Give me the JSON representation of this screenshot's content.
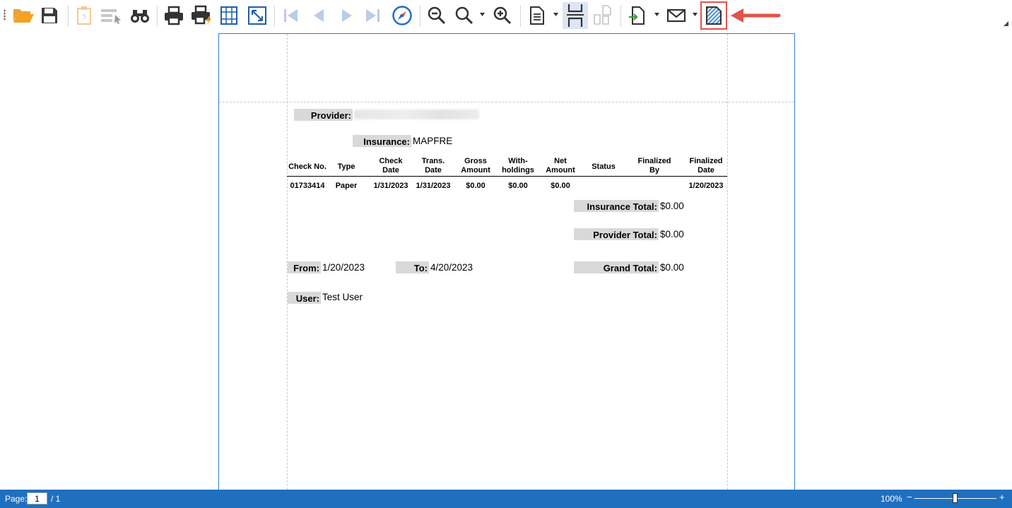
{
  "toolbar": {
    "buttons": [
      {
        "name": "open-icon"
      },
      {
        "name": "save-icon"
      },
      {
        "name": "parameters-icon"
      },
      {
        "name": "document-map-icon"
      },
      {
        "name": "find-icon"
      },
      {
        "name": "print-icon"
      },
      {
        "name": "quick-print-icon"
      },
      {
        "name": "page-setup-icon"
      },
      {
        "name": "scale-icon"
      },
      {
        "name": "first-page-icon"
      },
      {
        "name": "previous-page-icon"
      },
      {
        "name": "next-page-icon"
      },
      {
        "name": "last-page-icon"
      },
      {
        "name": "navigation-icon"
      },
      {
        "name": "zoom-out-icon"
      },
      {
        "name": "zoom-icon"
      },
      {
        "name": "zoom-in-icon"
      },
      {
        "name": "single-page-icon"
      },
      {
        "name": "continuous-scroll-icon"
      },
      {
        "name": "multiple-pages-icon"
      },
      {
        "name": "export-icon"
      },
      {
        "name": "send-email-icon"
      },
      {
        "name": "watermark-icon"
      }
    ],
    "highlight_color": "#e0534a"
  },
  "report": {
    "provider_label": "Provider:",
    "insurance_label": "Insurance:",
    "insurance_value": "MAPFRE",
    "columns": [
      {
        "key": "check_no",
        "label": "Check No."
      },
      {
        "key": "type",
        "label": "Type"
      },
      {
        "key": "check_date",
        "label": "Check\nDate"
      },
      {
        "key": "trans_date",
        "label": "Trans.\nDate"
      },
      {
        "key": "gross_amount",
        "label": "Gross\nAmount"
      },
      {
        "key": "withholdings",
        "label": "With-\nholdings"
      },
      {
        "key": "net_amount",
        "label": "Net\nAmount"
      },
      {
        "key": "status",
        "label": "Status"
      },
      {
        "key": "finalized_by",
        "label": "Finalized\nBy"
      },
      {
        "key": "finalized_date",
        "label": "Finalized\nDate"
      }
    ],
    "rows": [
      {
        "check_no": "01733414",
        "type": "Paper",
        "check_date": "1/31/2023",
        "trans_date": "1/31/2023",
        "gross_amount": "$0.00",
        "withholdings": "$0.00",
        "net_amount": "$0.00",
        "status": "",
        "finalized_by": "",
        "finalized_date": "1/20/2023"
      }
    ],
    "insurance_total_label": "Insurance Total:",
    "insurance_total_value": "$0.00",
    "provider_total_label": "Provider Total:",
    "provider_total_value": "$0.00",
    "from_label": "From:",
    "from_value": "1/20/2023",
    "to_label": "To:",
    "to_value": "4/20/2023",
    "grand_total_label": "Grand Total:",
    "grand_total_value": "$0.00",
    "user_label": "User:",
    "user_value": "Test User"
  },
  "statusbar": {
    "page_label": "Page:",
    "page_current": "1",
    "page_total": "/ 1",
    "zoom_level": "100%",
    "zoom_out_symbol": "−",
    "zoom_in_symbol": "+",
    "background": "#1e70bf"
  }
}
